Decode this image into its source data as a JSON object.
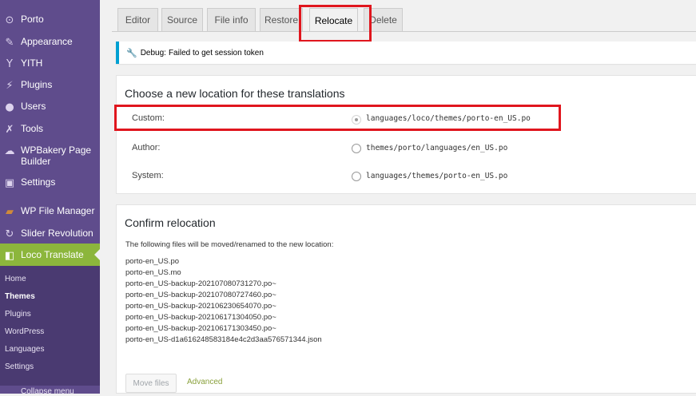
{
  "sidebar": {
    "items": [
      {
        "label": "Porto",
        "icon": "porto-icon"
      },
      {
        "label": "Appearance",
        "icon": "paintbrush-icon"
      },
      {
        "label": "YITH",
        "icon": "yith-icon"
      },
      {
        "label": "Plugins",
        "icon": "plugin-icon"
      },
      {
        "label": "Users",
        "icon": "users-icon"
      },
      {
        "label": "Tools",
        "icon": "wrench-icon"
      },
      {
        "label": "WPBakery Page Builder",
        "icon": "wpbakery-icon"
      },
      {
        "label": "Settings",
        "icon": "settings-icon"
      },
      {
        "label": "WP File Manager",
        "icon": "file-manager-icon"
      },
      {
        "label": "Slider Revolution",
        "icon": "slider-revolution-icon"
      },
      {
        "label": "Loco Translate",
        "icon": "loco-icon"
      }
    ],
    "submenu": [
      "Home",
      "Themes",
      "Plugins",
      "WordPress",
      "Languages",
      "Settings"
    ],
    "current_sub": "Themes",
    "collapse": "Collapse menu"
  },
  "tabs": [
    "Editor",
    "Source",
    "File info",
    "Restore",
    "Relocate",
    "Delete"
  ],
  "active_tab": "Relocate",
  "notice": {
    "prefix": "Debug:",
    "text": "Failed to get session token",
    "icon": "wrench-icon"
  },
  "location_panel": {
    "title": "Choose a new location for these translations",
    "options": [
      {
        "label": "Custom:",
        "path": "languages/loco/themes/porto-en_US.po",
        "checked": true
      },
      {
        "label": "Author:",
        "path": "themes/porto/languages/en_US.po",
        "checked": false
      },
      {
        "label": "System:",
        "path": "languages/themes/porto-en_US.po",
        "checked": false
      }
    ]
  },
  "confirm_panel": {
    "title": "Confirm relocation",
    "intro": "The following files will be moved/renamed to the new location:",
    "files": [
      "porto-en_US.po",
      "porto-en_US.mo",
      "porto-en_US-backup-202107080731270.po~",
      "porto-en_US-backup-202107080727460.po~",
      "porto-en_US-backup-202106230654070.po~",
      "porto-en_US-backup-202106171304050.po~",
      "porto-en_US-backup-202106171303450.po~",
      "porto-en_US-d1a616248583184e4c2d3aa576571344.json"
    ],
    "move_button": "Move files",
    "advanced_link": "Advanced"
  },
  "colors": {
    "sidebar": "#5f4c8c",
    "active_menu": "#8cb63c",
    "highlight": "#e0161e",
    "notice_border": "#00a0d2"
  }
}
